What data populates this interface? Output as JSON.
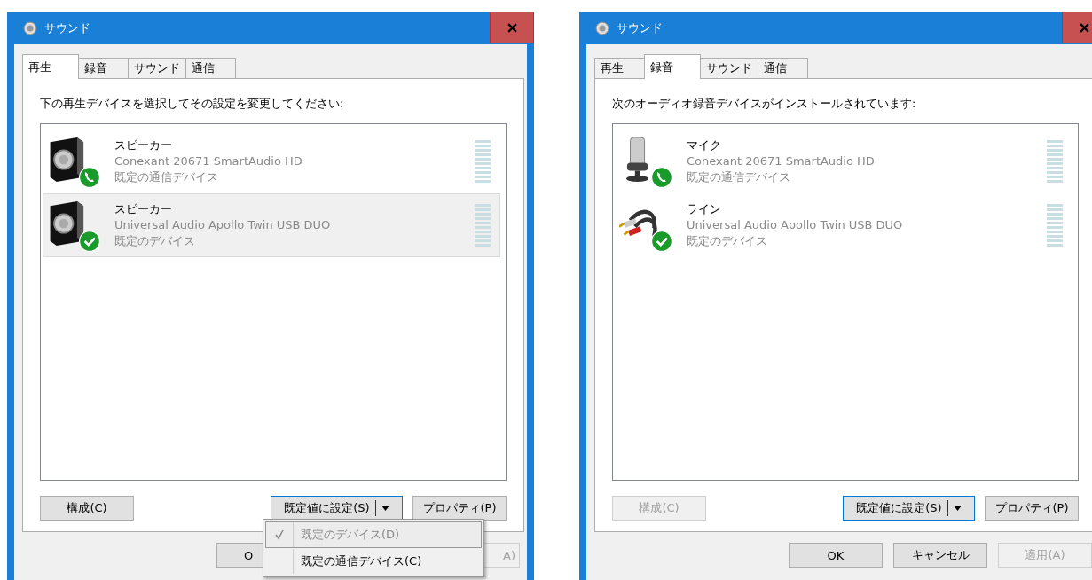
{
  "windows": [
    {
      "title": "サウンド",
      "tabs": [
        {
          "label": "再生",
          "selected": true
        },
        {
          "label": "録音",
          "selected": false
        },
        {
          "label": "サウンド",
          "selected": false
        },
        {
          "label": "通信",
          "selected": false
        }
      ],
      "instruction": "下の再生デバイスを選択してその設定を変更してください:",
      "devices": [
        {
          "name": "スピーカー",
          "driver": "Conexant 20671 SmartAudio HD",
          "status": "既定の通信デバイス",
          "kind": "speaker",
          "badge": {
            "kind": "phone"
          },
          "selected": false
        },
        {
          "name": "スピーカー",
          "driver": "Universal Audio Apollo Twin USB DUO",
          "status": "既定のデバイス",
          "kind": "speaker",
          "badge": {
            "kind": "check"
          },
          "selected": true
        }
      ],
      "configure": {
        "label": "構成(C)",
        "disabled": false
      },
      "set_default": {
        "label": "既定値に設定(S)"
      },
      "properties": {
        "label": "プロパティ(P)"
      },
      "menu": {
        "items": [
          {
            "label": "既定のデバイス(D)",
            "checked": true,
            "disabled": true
          },
          {
            "label": "既定の通信デバイス(C)",
            "checked": false,
            "disabled": false
          }
        ]
      },
      "dialog_buttons": [
        {
          "kind": "ok",
          "label": "O",
          "disabled": false
        },
        {
          "kind": "apply",
          "label": "A)",
          "disabled": true
        }
      ]
    },
    {
      "title": "サウンド",
      "tabs": [
        {
          "label": "再生",
          "selected": false
        },
        {
          "label": "録音",
          "selected": true
        },
        {
          "label": "サウンド",
          "selected": false
        },
        {
          "label": "通信",
          "selected": false
        }
      ],
      "instruction": "次のオーディオ録音デバイスがインストールされています:",
      "devices": [
        {
          "name": "マイク",
          "driver": "Conexant 20671 SmartAudio HD",
          "status": "既定の通信デバイス",
          "kind": "mic",
          "badge": {
            "kind": "phone"
          },
          "selected": false
        },
        {
          "name": "ライン",
          "driver": "Universal Audio Apollo Twin USB DUO",
          "status": "既定のデバイス",
          "kind": "line",
          "badge": {
            "kind": "check"
          },
          "selected": false
        }
      ],
      "configure": {
        "label": "構成(C)",
        "disabled": true
      },
      "set_default": {
        "label": "既定値に設定(S)"
      },
      "properties": {
        "label": "プロパティ(P)"
      },
      "dialog_buttons": [
        {
          "kind": "ok",
          "label": "OK",
          "disabled": false
        },
        {
          "kind": "cancel",
          "label": "キャンセル",
          "disabled": false
        },
        {
          "kind": "apply",
          "label": "適用(A)",
          "disabled": true
        }
      ]
    }
  ]
}
